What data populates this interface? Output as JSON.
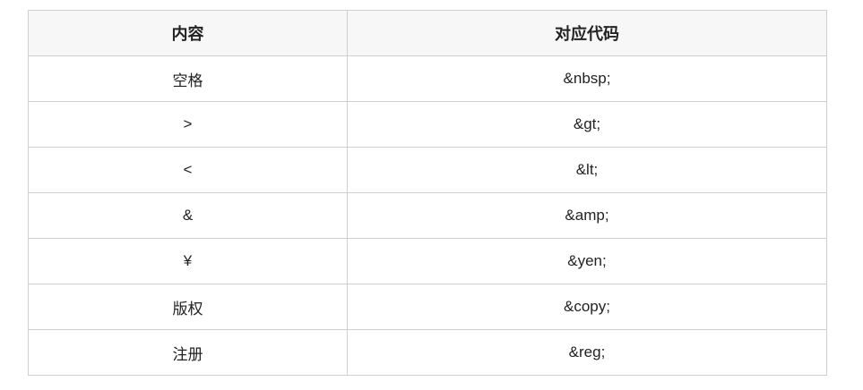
{
  "table": {
    "headers": [
      "内容",
      "对应代码"
    ],
    "rows": [
      {
        "content": "空格",
        "code": "&nbsp;"
      },
      {
        "content": ">",
        "code": "&gt;"
      },
      {
        "content": "<",
        "code": "&lt;"
      },
      {
        "content": "&",
        "code": "&amp;"
      },
      {
        "content": "¥",
        "code": "&yen;"
      },
      {
        "content": "版权",
        "code": "&copy;"
      },
      {
        "content": "注册",
        "code": "&reg;"
      }
    ]
  }
}
